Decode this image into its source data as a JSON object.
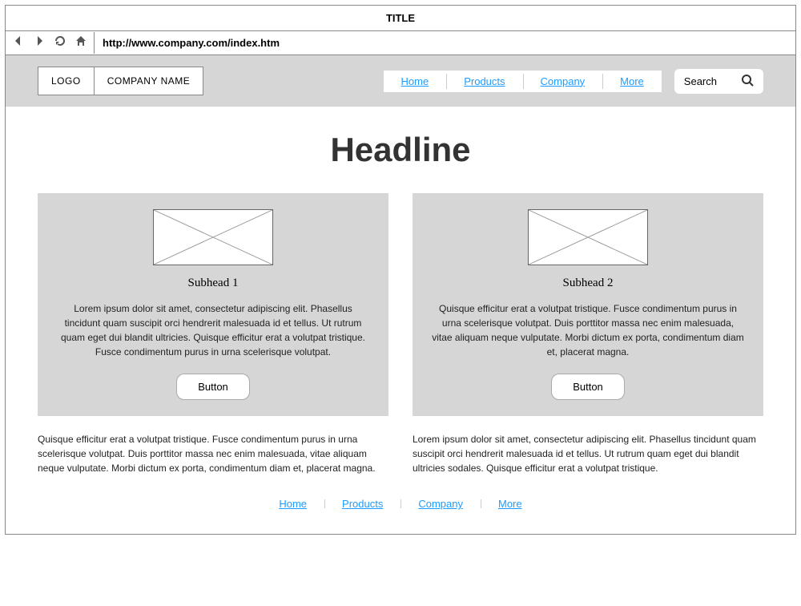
{
  "window": {
    "title": "TITLE"
  },
  "browser": {
    "url": "http://www.company.com/index.htm"
  },
  "header": {
    "logo": "LOGO",
    "company": "COMPANY NAME",
    "nav": [
      "Home",
      "Products",
      "Company",
      "More"
    ],
    "search_placeholder": "Search"
  },
  "main": {
    "headline": "Headline",
    "cards": [
      {
        "subhead": "Subhead 1",
        "body": "Lorem ipsum dolor sit amet, consectetur adipiscing elit. Phasellus tincidunt quam suscipit orci hendrerit malesuada id et tellus. Ut rutrum quam eget dui blandit ultricies. Quisque efficitur erat a volutpat tristique. Fusce condimentum purus in urna scelerisque volutpat.",
        "button": "Button"
      },
      {
        "subhead": "Subhead 2",
        "body": "Quisque efficitur erat a volutpat tristique. Fusce condimentum purus in urna scelerisque volutpat. Duis porttitor massa nec enim malesuada, vitae aliquam neque vulputate. Morbi dictum ex porta, condimentum diam et, placerat magna.",
        "button": "Button"
      }
    ],
    "below": [
      "Quisque efficitur erat a volutpat tristique. Fusce condimentum purus in urna scelerisque volutpat. Duis porttitor massa nec enim malesuada, vitae aliquam neque vulputate. Morbi dictum ex porta, condimentum diam et, placerat magna.",
      "Lorem ipsum dolor sit amet, consectetur adipiscing elit. Phasellus tincidunt quam suscipit orci hendrerit malesuada id et tellus. Ut rutrum quam eget dui blandit ultricies sodales. Quisque efficitur erat a volutpat tristique."
    ]
  },
  "footer": {
    "links": [
      "Home",
      "Products",
      "Company",
      "More"
    ]
  }
}
